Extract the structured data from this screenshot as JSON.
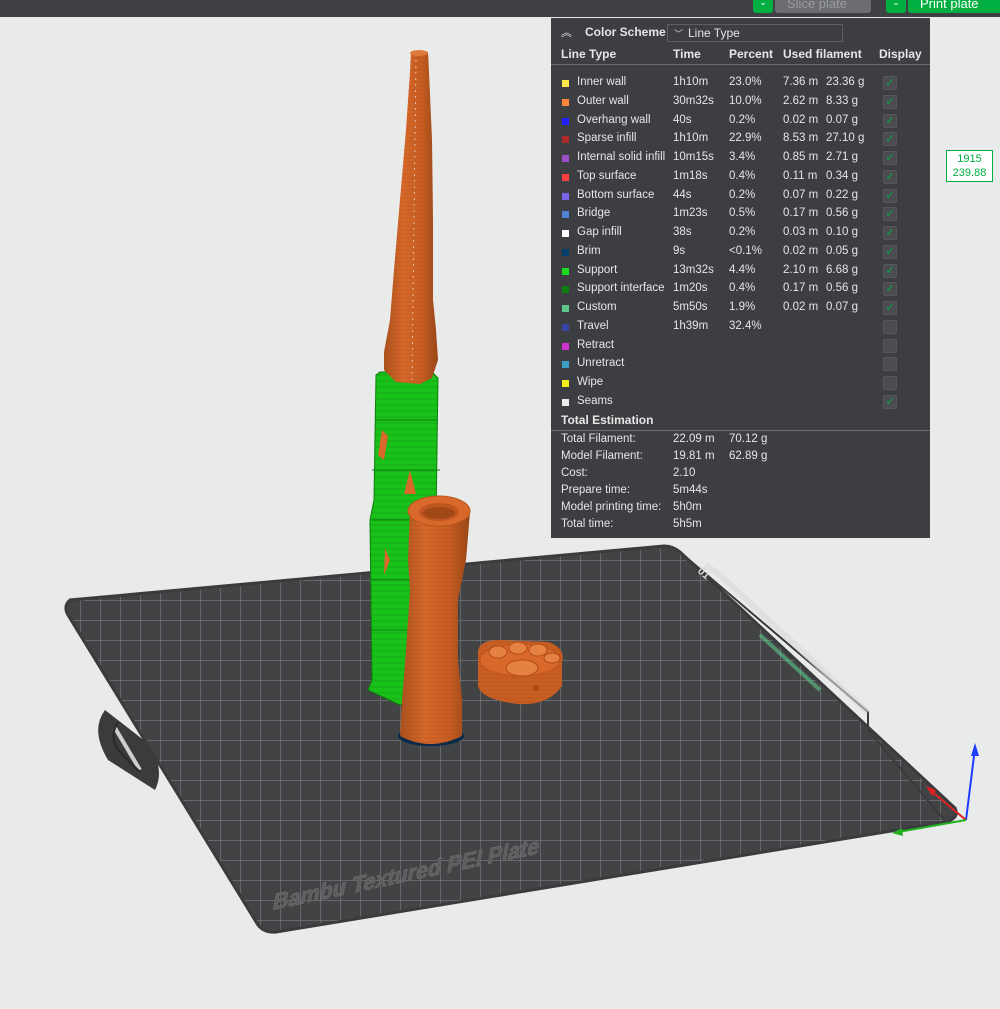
{
  "toolbar": {
    "slice_label": "Slice plate",
    "print_label": "Print plate",
    "dropdown_glyph": "⌄"
  },
  "legend": {
    "title": "Color Scheme",
    "scheme_selected": "Line Type",
    "columns": {
      "type": "Line Type",
      "time": "Time",
      "percent": "Percent",
      "used": "Used filament",
      "display": "Display"
    },
    "rows": [
      {
        "name": "Inner wall",
        "color": "#ffe74b",
        "time": "1h10m",
        "percent": "23.0%",
        "length": "7.36 m",
        "weight": "23.36 g",
        "display": true
      },
      {
        "name": "Outer wall",
        "color": "#ff8636",
        "time": "30m32s",
        "percent": "10.0%",
        "length": "2.62 m",
        "weight": "8.33 g",
        "display": true
      },
      {
        "name": "Overhang wall",
        "color": "#1f1fff",
        "time": "40s",
        "percent": "0.2%",
        "length": "0.02 m",
        "weight": "0.07 g",
        "display": true
      },
      {
        "name": "Sparse infill",
        "color": "#b22b2b",
        "time": "1h10m",
        "percent": "22.9%",
        "length": "8.53 m",
        "weight": "27.10 g",
        "display": true
      },
      {
        "name": "Internal solid infill",
        "color": "#9a4fc8",
        "time": "10m15s",
        "percent": "3.4%",
        "length": "0.85 m",
        "weight": "2.71 g",
        "display": true
      },
      {
        "name": "Top surface",
        "color": "#ff4040",
        "time": "1m18s",
        "percent": "0.4%",
        "length": "0.11 m",
        "weight": "0.34 g",
        "display": true
      },
      {
        "name": "Bottom surface",
        "color": "#7a63e8",
        "time": "44s",
        "percent": "0.2%",
        "length": "0.07 m",
        "weight": "0.22 g",
        "display": true
      },
      {
        "name": "Bridge",
        "color": "#4d82d6",
        "time": "1m23s",
        "percent": "0.5%",
        "length": "0.17 m",
        "weight": "0.56 g",
        "display": true
      },
      {
        "name": "Gap infill",
        "color": "#ffffff",
        "time": "38s",
        "percent": "0.2%",
        "length": "0.03 m",
        "weight": "0.10 g",
        "display": true
      },
      {
        "name": "Brim",
        "color": "#00406b",
        "time": "9s",
        "percent": "<0.1%",
        "length": "0.02 m",
        "weight": "0.05 g",
        "display": true
      },
      {
        "name": "Support",
        "color": "#1bdc1b",
        "time": "13m32s",
        "percent": "4.4%",
        "length": "2.10 m",
        "weight": "6.68 g",
        "display": true
      },
      {
        "name": "Support interface",
        "color": "#0d7d0d",
        "time": "1m20s",
        "percent": "0.4%",
        "length": "0.17 m",
        "weight": "0.56 g",
        "display": true
      },
      {
        "name": "Custom",
        "color": "#5ec68a",
        "time": "5m50s",
        "percent": "1.9%",
        "length": "0.02 m",
        "weight": "0.07 g",
        "display": true
      },
      {
        "name": "Travel",
        "color": "#3844a8",
        "time": "1h39m",
        "percent": "32.4%",
        "length": "",
        "weight": "",
        "display": false
      },
      {
        "name": "Retract",
        "color": "#cc33cc",
        "time": "",
        "percent": "",
        "length": "",
        "weight": "",
        "display": false
      },
      {
        "name": "Unretract",
        "color": "#3a9fc7",
        "time": "",
        "percent": "",
        "length": "",
        "weight": "",
        "display": false
      },
      {
        "name": "Wipe",
        "color": "#f5ee18",
        "time": "",
        "percent": "",
        "length": "",
        "weight": "",
        "display": false
      },
      {
        "name": "Seams",
        "color": "#ececec",
        "time": "",
        "percent": "",
        "length": "",
        "weight": "",
        "display": true
      }
    ],
    "total_title": "Total Estimation",
    "totals": [
      {
        "label": "Total Filament:",
        "v1": "22.09 m",
        "v2": "70.12 g"
      },
      {
        "label": "Model Filament:",
        "v1": "19.81 m",
        "v2": "62.89 g"
      },
      {
        "label": "Cost:",
        "v1": "2.10",
        "v2": ""
      },
      {
        "label": "Prepare time:",
        "v1": "5m44s",
        "v2": ""
      },
      {
        "label": "Model printing time:",
        "v1": "5h0m",
        "v2": ""
      },
      {
        "label": "Total time:",
        "v1": "5h5m",
        "v2": ""
      }
    ]
  },
  "ruler": {
    "layer": "1915",
    "height": "239.88"
  },
  "plate": {
    "label": "Bambu Textured PEI Plate",
    "corner_label": "01"
  },
  "colors": {
    "accent": "#00ae42",
    "panel_bg": "#3d3e42",
    "plate": "#424345",
    "wall": "#d0601f",
    "support": "#1bdc1b"
  }
}
